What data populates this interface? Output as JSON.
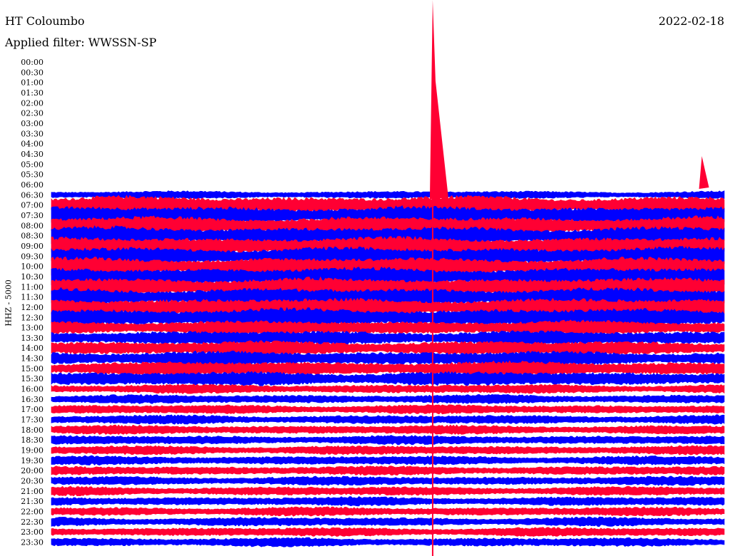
{
  "header": {
    "station": "HT Coloumbo",
    "date": "2022-02-18",
    "filter_label": "Applied filter: WWSSN-SP"
  },
  "axis": {
    "channel_label": "HHZ - 5000"
  },
  "chart_data": {
    "type": "line",
    "title": "",
    "row_labels": [
      "00:00",
      "00:30",
      "01:00",
      "01:30",
      "02:00",
      "02:30",
      "03:00",
      "03:30",
      "04:00",
      "04:30",
      "05:00",
      "05:30",
      "06:00",
      "06:30",
      "07:00",
      "07:30",
      "08:00",
      "08:30",
      "09:00",
      "09:30",
      "10:00",
      "10:30",
      "11:00",
      "11:30",
      "12:00",
      "12:30",
      "13:00",
      "13:30",
      "14:00",
      "14:30",
      "15:00",
      "15:30",
      "16:00",
      "16:30",
      "17:00",
      "17:30",
      "18:00",
      "18:30",
      "19:00",
      "19:30",
      "20:00",
      "20:30",
      "21:00",
      "21:30",
      "22:00",
      "22:30",
      "23:00",
      "23:30"
    ],
    "row_interval_minutes": 30,
    "first_trace_row": "06:30",
    "series_colors": [
      "#0000ff",
      "#ff0033"
    ],
    "events": [
      {
        "row": "06:30",
        "minute": 17,
        "description": "large spike"
      },
      {
        "row": "06:00",
        "minute": 29,
        "description": "small spike"
      }
    ]
  }
}
